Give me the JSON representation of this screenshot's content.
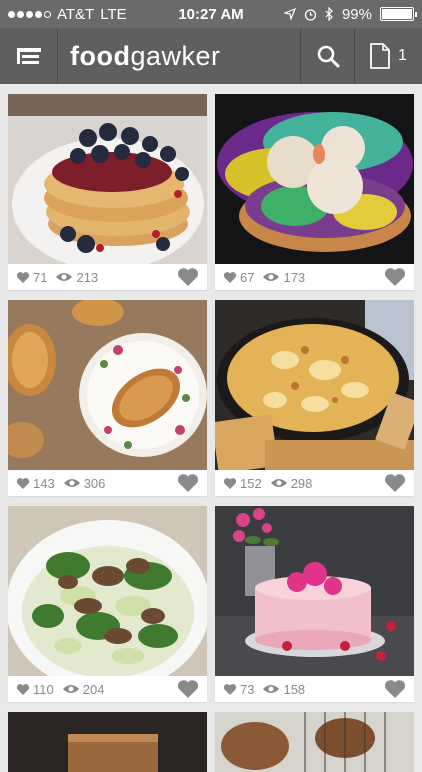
{
  "status": {
    "carrier": "AT&T",
    "network": "LTE",
    "time": "10:27 AM",
    "battery": "99%",
    "battery_level": 0.99
  },
  "nav": {
    "logo_bold": "food",
    "logo_light": "gawker",
    "doc_count": "1"
  },
  "cards": [
    {
      "likes": "71",
      "views": "213"
    },
    {
      "likes": "67",
      "views": "173"
    },
    {
      "likes": "143",
      "views": "306"
    },
    {
      "likes": "152",
      "views": "298"
    },
    {
      "likes": "110",
      "views": "204"
    },
    {
      "likes": "73",
      "views": "158"
    }
  ],
  "icons": {
    "menu": "menu-icon",
    "search": "search-icon",
    "document": "document-icon",
    "heart": "heart-icon",
    "eye": "eye-icon"
  },
  "colors": {
    "navbar": "#5f5f5f",
    "statusbar": "#6a6a6a",
    "meta_text": "#8a8a8a",
    "background": "#e9e9e9"
  }
}
